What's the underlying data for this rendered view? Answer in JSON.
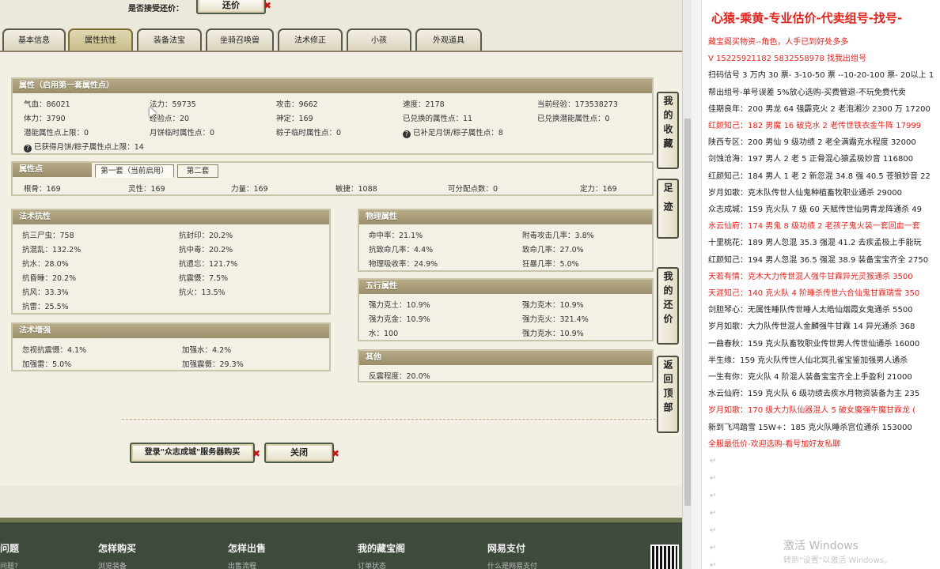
{
  "game": {
    "offer_label": "是否接受还价：",
    "offer_button": "还价",
    "tabs": [
      "基本信息",
      "属性抗性",
      "装备法宝",
      "坐骑召唤兽",
      "法术修正",
      "小孩",
      "外观道具"
    ],
    "active_tab": 1,
    "attrs": {
      "title": "属性（启用第一套属性点）",
      "cells": [
        "气血：86021",
        "法力：59735",
        "攻击：9662",
        "速度：2178",
        "当前经验：173538273",
        "体力：3790",
        "经验点：20",
        "神定：169",
        "已兑换的属性点：11",
        "已兑换潜能属性点：0",
        "潜能属性点上限：0",
        "月饼临时属性点：0",
        "粽子临时属性点：0",
        "已补足月饼/粽子属性点：8"
      ],
      "note": "已获得月饼/粽子属性点上限：14"
    },
    "points": {
      "title": "属性点",
      "tab1": "第一套（当前启用）",
      "tab2": "第二套",
      "cells": [
        "根骨：169",
        "灵性：169",
        "力量：169",
        "敏捷：1088",
        "可分配点数：0",
        "定力：169"
      ]
    },
    "resist": {
      "title": "法术抗性",
      "cells": [
        "抗三尸虫：758",
        "抗封印：20.2%",
        "抗混乱：132.2%",
        "抗中毒：20.2%",
        "抗水：28.0%",
        "抗遗忘：121.7%",
        "抗昏睡：20.2%",
        "抗震慑：7.5%",
        "抗风：33.3%",
        "抗火：13.5%",
        "抗雷：25.5%"
      ]
    },
    "boost": {
      "title": "法术增强",
      "cells": [
        "忽视抗震慑：4.1%",
        "加强水：4.2%",
        "加强雷：5.0%",
        "加强震慑：29.3%"
      ]
    },
    "physical": {
      "title": "物理属性",
      "cells": [
        "命中率：21.1%",
        "附毒攻击几率：3.8%",
        "抗致命几率：4.4%",
        "致命几率：27.0%",
        "物理吸收率：24.9%",
        "狂暴几率：5.0%"
      ]
    },
    "elements": {
      "title": "五行属性",
      "cells": [
        "强力克土：10.9%",
        "强力克木：10.9%",
        "强力克金：10.9%",
        "强力克火：321.4%",
        "水：100",
        "强力克水：10.9%"
      ]
    },
    "other": {
      "title": "其他",
      "cells": [
        "反震程度：20.0%"
      ]
    },
    "buy_button": "登录\"众志成城\"服务器购买",
    "close_button": "关闭",
    "side_buttons": [
      "我的收藏",
      "足迹",
      "我的还价",
      "返回顶部"
    ],
    "footer": [
      "问题",
      "怎样购买",
      "怎样出售",
      "我的藏宝阁",
      "网易支付"
    ],
    "footer_sub": [
      "问题?",
      "浏览装备",
      "出售流程",
      "订单状态",
      "什么是网易支付"
    ]
  },
  "notes": {
    "title": "心猿-乘黄-专业估价-代卖组号-找号-",
    "lines": [
      {
        "text": "藏宝阁买物资--角色，人手已到好处多多",
        "red": true
      },
      {
        "text": "V 15225921182  5832558978 找我出组号",
        "red": true
      },
      {
        "text": "扫码估号 3 万内 30 票- 3-10-50 票  --10-20-100 票- 20以上 1",
        "red": false
      },
      {
        "text": "帮出组号-单号误差 5%放心选购-买费管退-不玩免费代卖",
        "red": false
      },
      {
        "text": "佳期良年：200 男龙 64 强霹克火 2 老泡湘沙 2300 万 17200",
        "red": false
      },
      {
        "text": "红颜知己：182 男魔 16 破克水 2 老传世铁衣金牛阵 17999",
        "red": true
      },
      {
        "text": "陕西专区：200 男仙 9 级功绩 2 老全满霜克水程度 32000",
        "red": false
      },
      {
        "text": "剑蚀沧海：197 男人 2 老 5 正骨混心猿孟极妙音 116800",
        "red": false
      },
      {
        "text": "红颜知己：184 男人 1 老 2 新忽混 34.8 强 40.5 苍狼妙音 22",
        "red": false
      },
      {
        "text": "岁月如歌：克木队传世人仙鬼种植畜牧职业通杀 29000",
        "red": false
      },
      {
        "text": "众志成城：159 克火队 7 级 60 天赋传世仙男青龙阵通杀 49",
        "red": false
      },
      {
        "text": "水云仙府：174 男鬼 8 级功绩 2 老孩子鬼火装一套回血一套",
        "red": true
      },
      {
        "text": "十里桃花：189 男人忽混 35.3 强混 41.2 去疾孟极上手能玩",
        "red": false
      },
      {
        "text": "红颜知己：194 男人忽混 36.5 强混 38.9 装备宝宝齐全 2750",
        "red": false
      },
      {
        "text": "天若有情：克木大力传世混人强牛甘霖异光灵猴通杀 3500",
        "red": true
      },
      {
        "text": "天涯知己：140 克火队 4 阶睡杀传世六合仙鬼甘霖瑞雪 350",
        "red": true
      },
      {
        "text": "剑胆琴心：无属性睡队传世睡人太皓仙烟霞女鬼通杀 5500",
        "red": false
      },
      {
        "text": "岁月如歌：大力队传世混人金麟强牛甘霖 14 异光通杀 368",
        "red": false
      },
      {
        "text": "一曲春秋：159 克火队畜牧职业传世男人传世仙通杀 16000",
        "red": false
      },
      {
        "text": "半生缘：159 克火队传世人仙北冥孔雀宝鉴加强男人通杀",
        "red": false
      },
      {
        "text": "一生有你：克火队 4 阶混人装备宝宝齐全上手盈利 21000",
        "red": false
      },
      {
        "text": "水云仙府：159 克火队 6 级功绩去疾水月物资装备为主 235",
        "red": false
      },
      {
        "text": "岁月如歌：170 级大力队仙器混人 5 破女魔强牛魔甘霖龙 (",
        "red": true
      },
      {
        "text": "新到飞鸿踏雪 15W+：185 克火队睡杀宫位通杀 153000",
        "red": false
      },
      {
        "text": "全服最低价-欢迎选购-看号加好友私聊",
        "red": true
      }
    ],
    "paragraph_mark": "↵"
  },
  "watermark": {
    "line1": "激活 Windows",
    "line2": "转到\"设置\"以激活 Windows。"
  },
  "colors": {
    "panel_header": "#a89d78",
    "accent_red": "#e0251f",
    "footer_bg": "#3e4a3c"
  }
}
